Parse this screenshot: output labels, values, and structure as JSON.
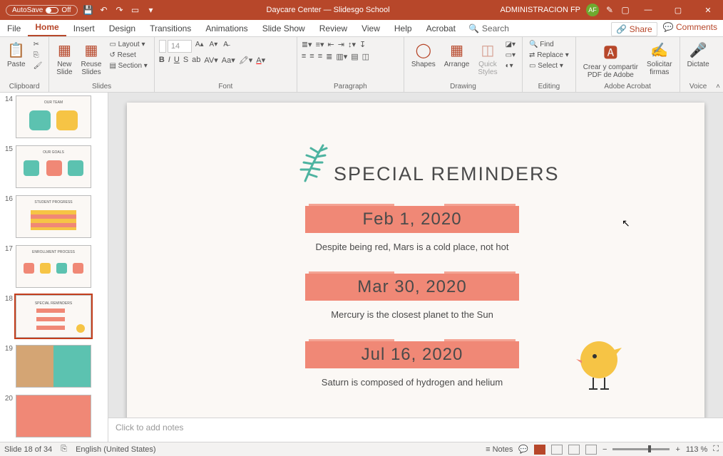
{
  "titlebar": {
    "autosave_label": "AutoSave",
    "autosave_state": "Off",
    "doc_title": "Daycare Center — Slidesgo School",
    "user_name": "ADMINISTRACION FP",
    "user_initials": "AF"
  },
  "tabs": {
    "items": [
      "File",
      "Home",
      "Insert",
      "Design",
      "Transitions",
      "Animations",
      "Slide Show",
      "Review",
      "View",
      "Help",
      "Acrobat"
    ],
    "active": "Home",
    "search": "Search",
    "share": "Share",
    "comments": "Comments"
  },
  "ribbon": {
    "clipboard": {
      "paste": "Paste",
      "label": "Clipboard"
    },
    "slides": {
      "new": "New\nSlide",
      "reuse": "Reuse\nSlides",
      "layout": "Layout",
      "reset": "Reset",
      "section": "Section",
      "label": "Slides"
    },
    "font": {
      "name": "",
      "size": "14",
      "label": "Font"
    },
    "paragraph": {
      "label": "Paragraph"
    },
    "drawing": {
      "shapes": "Shapes",
      "arrange": "Arrange",
      "quick": "Quick\nStyles",
      "label": "Drawing"
    },
    "editing": {
      "find": "Find",
      "replace": "Replace",
      "select": "Select",
      "label": "Editing"
    },
    "adobe": {
      "share_pdf": "Crear y compartir\nPDF de Adobe",
      "sign": "Solicitar\nfirmas",
      "label": "Adobe Acrobat"
    },
    "voice": {
      "dictate": "Dictate",
      "label": "Voice"
    }
  },
  "thumbs": [
    {
      "num": "14"
    },
    {
      "num": "15"
    },
    {
      "num": "16"
    },
    {
      "num": "17"
    },
    {
      "num": "18",
      "selected": true
    },
    {
      "num": "19"
    },
    {
      "num": "20"
    }
  ],
  "slide": {
    "title": "SPECIAL REMINDERS",
    "items": [
      {
        "date": "Feb 1, 2020",
        "desc": "Despite being red, Mars is a cold place, not hot"
      },
      {
        "date": "Mar 30, 2020",
        "desc": "Mercury is the closest planet to the Sun"
      },
      {
        "date": "Jul 16, 2020",
        "desc": "Saturn is composed of hydrogen and helium"
      }
    ]
  },
  "notes_placeholder": "Click to add notes",
  "status": {
    "slide_info": "Slide 18 of 34",
    "language": "English (United States)",
    "notes": "Notes",
    "zoom": "113 %"
  }
}
